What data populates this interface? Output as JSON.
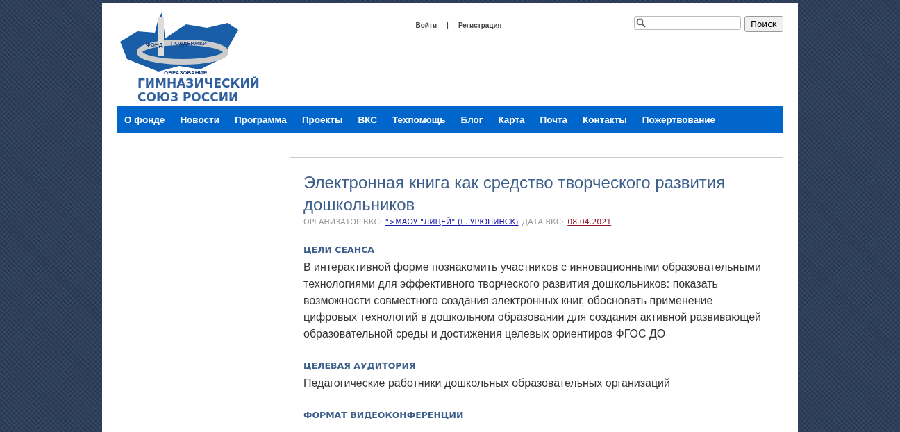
{
  "logo": {
    "ring_words": [
      "ФОНД",
      "ПОДДЕРЖКИ",
      "ОБРАЗОВАНИЯ"
    ],
    "title_lines": [
      "ГИМНАЗИЧЕСКИЙ",
      "СОЮЗ РОССИИ"
    ]
  },
  "auth_links": [
    "Войти",
    "|",
    "Регистрация"
  ],
  "search": {
    "button": "Поиск"
  },
  "nav": [
    "О фонде",
    "Новости",
    "Программа",
    "Проекты",
    "ВКС",
    "Техпомощь",
    "Блог",
    "Карта",
    "Почта",
    "Контакты",
    "Пожертвование"
  ],
  "article": {
    "title": "Электронная книга как средство творческого развития дошкольников",
    "meta": [
      {
        "kind": "label",
        "text": "ОРГАНИЗАТОР ВКС:"
      },
      {
        "kind": "link",
        "text": "\">МАОУ \"ЛИЦЕЙ\" (Г. УРЮПИНСК)"
      },
      {
        "kind": "label",
        "text": "ДАТА ВКС:"
      },
      {
        "kind": "date",
        "text": "08.04.2021"
      }
    ],
    "sections": [
      {
        "heading": "ЦЕЛИ СЕАНСА",
        "body": "В интерактивной форме познакомить участников с инновационными образовательными технологиями для эффективного творческого развития дошкольников: показать возможности совместного создания электронных книг, обосновать применение цифровых технологий в дошкольном образовании для создания активной развивающей образовательной среды и достижения целевых ориентиров ФГОС ДО"
      },
      {
        "heading": "ЦЕЛЕВАЯ АУДИТОРИЯ",
        "body": "Педагогические работники дошкольных образовательных организаций"
      },
      {
        "heading": "ФОРМАТ ВИДЕОКОНФЕРЕНЦИИ"
      }
    ]
  }
}
